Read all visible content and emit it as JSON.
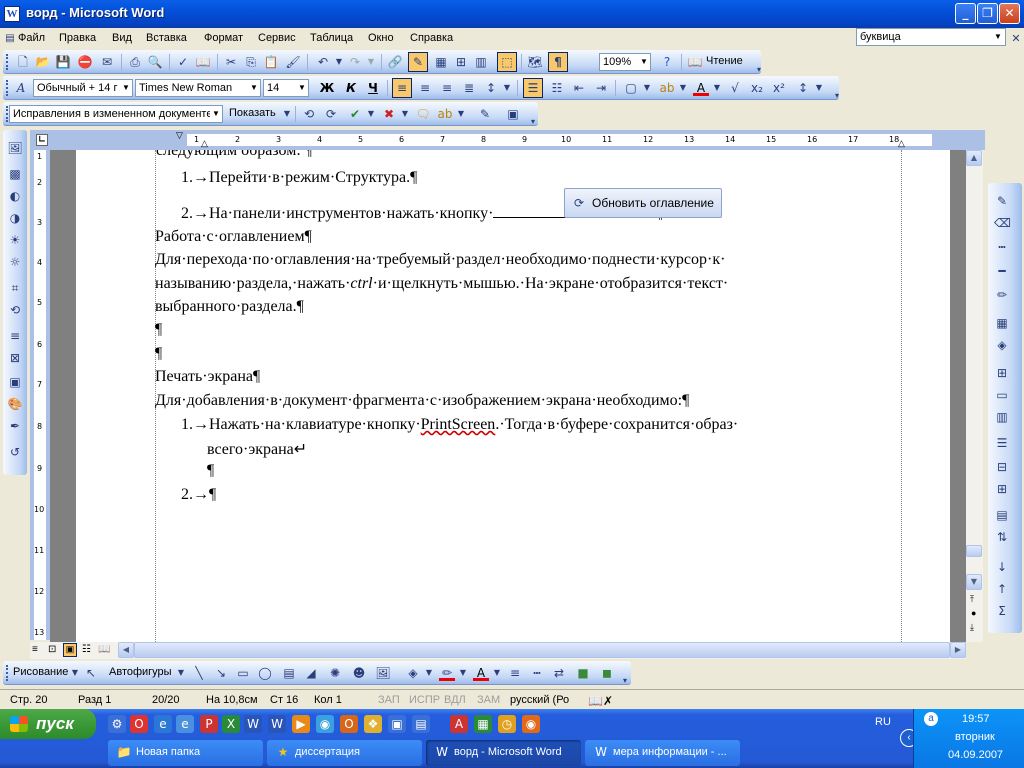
{
  "window": {
    "title": "ворд - Microsoft Word",
    "min": "_",
    "max": "❐",
    "close": "✕"
  },
  "menu": {
    "items": [
      "Файл",
      "Правка",
      "Вид",
      "Вставка",
      "Формат",
      "Сервис",
      "Таблица",
      "Окно",
      "Справка"
    ],
    "ask_box": "буквица"
  },
  "toolbar_standard": {
    "zoom": "109%",
    "reading": "Чтение"
  },
  "toolbar_format": {
    "style": "Обычный + 14 г",
    "font": "Times New Roman",
    "size": "14",
    "bold": "Ж",
    "italic": "К",
    "underline": "Ч"
  },
  "toolbar_review": {
    "mode": "Исправления в измененном документе",
    "show": "Показать"
  },
  "ruler": {
    "h_numbers": [
      "1",
      "2",
      "3",
      "4",
      "5",
      "6",
      "7",
      "8",
      "9",
      "10",
      "11",
      "12",
      "13",
      "14",
      "15",
      "16",
      "17",
      "18"
    ],
    "v_numbers": [
      "1",
      "2",
      "3",
      "4",
      "5",
      "6",
      "7",
      "8",
      "9",
      "10",
      "11",
      "12",
      "13"
    ]
  },
  "document": {
    "cut_line": "следующим образом: ¶",
    "l1": "1.→Перейти·в·режим·Структура.¶",
    "l2": "2.→На·панели·инструментов·нажать·кнопку·",
    "l2_end": ".¶",
    "update_button": "Обновить оглавление",
    "l3": "Работа·с·оглавлением¶",
    "l4": "Для·перехода·по·оглавления·на·требуемый·раздел·необходимо·поднести·курсор·к·",
    "l5a": "называнию·раздела,·нажать·",
    "l5i": "ctrl",
    "l5b": "·и·щелкнуть·мышью.·На·экране·отобразится·текст·",
    "l6": "выбранного·раздела.¶",
    "l7": "¶",
    "l8": "¶",
    "l9": "Печать·экрана¶",
    "l10": "Для·добавления·в·документ·фрагмента·с·изображением·экрана·необходимо:¶",
    "l11a": "1.→Нажать·на·клавиатуре·кнопку·",
    "l11b": "PrintScreen",
    "l11c": ".·Тогда·в·буфере·сохранится·образ·",
    "l12": "всего·экрана↵",
    "l13": "¶",
    "l14": "2.→¶"
  },
  "draw_toolbar": {
    "draw": "Рисование",
    "autoshapes": "Автофигуры"
  },
  "status": {
    "page": "Стр. 20",
    "section": "Разд 1",
    "pages": "20/20",
    "at": "На 10,8см",
    "line": "Ст 16",
    "col": "Кол 1",
    "rec": "ЗАП",
    "trk": "ИСПР",
    "ext": "ВДЛ",
    "ovr": "ЗАМ",
    "lang": "русский (Ро"
  },
  "taskbar": {
    "start": "пуск",
    "tasks": [
      "Новая папка",
      "диссертация",
      "ворд - Microsoft Word",
      "мера информации - ..."
    ],
    "lang": "RU",
    "time": "19:57",
    "day": "вторник",
    "date": "04.09.2007"
  }
}
